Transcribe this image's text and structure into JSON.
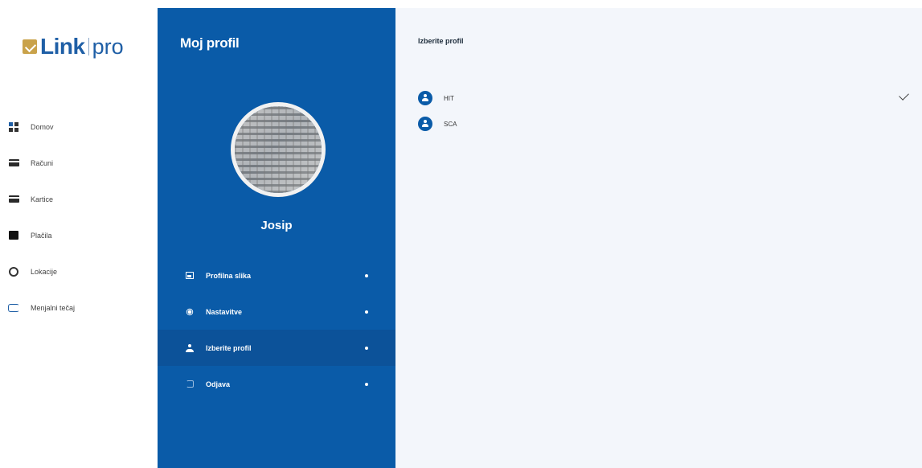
{
  "logo": {
    "brand": "Link",
    "suffix": "pro"
  },
  "left_nav": {
    "items": [
      {
        "label": "Domov",
        "icon": "dashboard-icon"
      },
      {
        "label": "Računi",
        "icon": "invoice-icon"
      },
      {
        "label": "Kartice",
        "icon": "card-icon"
      },
      {
        "label": "Plačila",
        "icon": "wallet-icon"
      },
      {
        "label": "Lokacije",
        "icon": "location-icon"
      },
      {
        "label": "Menjalni tečaj",
        "icon": "exchange-icon"
      }
    ]
  },
  "profile_panel": {
    "title": "Moj profil",
    "user_name": "Josip",
    "menu": [
      {
        "label": "Profilna slika",
        "icon": "image-icon"
      },
      {
        "label": "Nastavitve",
        "icon": "gear-icon"
      },
      {
        "label": "Izberite profil",
        "icon": "person-icon"
      },
      {
        "label": "Odjava",
        "icon": "logout-icon"
      }
    ]
  },
  "content": {
    "title": "Izberite profil",
    "profiles": [
      {
        "label": "HIT",
        "selected": true
      },
      {
        "label": "SCA",
        "selected": false
      }
    ]
  },
  "colors": {
    "brand_blue": "#0a5ba8",
    "gold": "#c9a24a",
    "content_bg": "#f3f6fb"
  }
}
